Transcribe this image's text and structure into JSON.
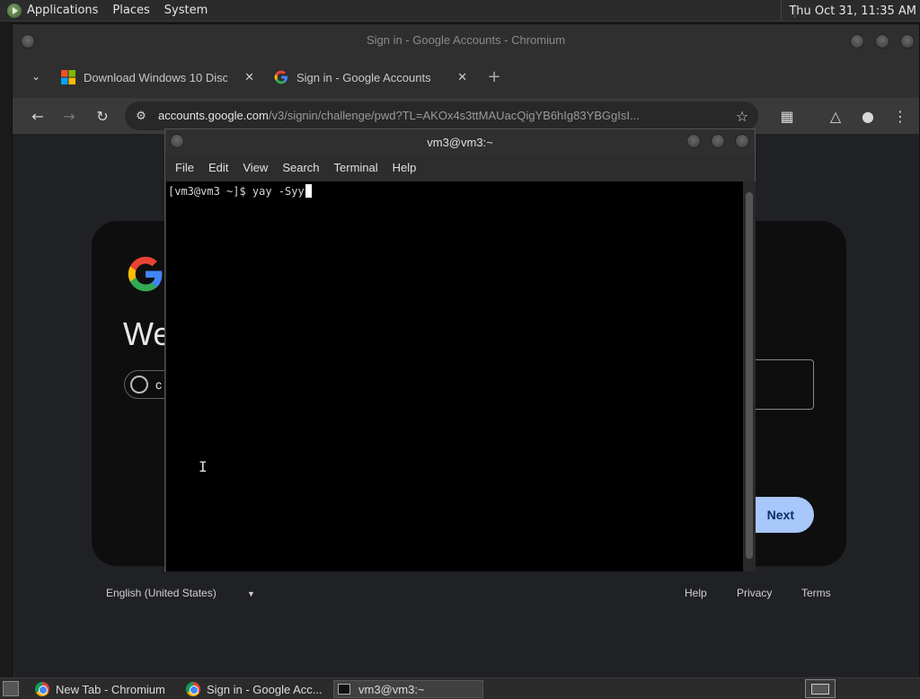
{
  "top_panel": {
    "menus": [
      "Applications",
      "Places",
      "System"
    ],
    "clock": "Thu Oct 31, 11:35 AM"
  },
  "browser": {
    "window_title": "Sign in - Google Accounts - Chromium",
    "tabs": [
      {
        "label": "Download Windows 10 Disc",
        "close": "✕"
      },
      {
        "label": "Sign in - Google Accounts",
        "close": "✕"
      }
    ],
    "new_tab": "+",
    "url_host": "accounts.google.com",
    "url_path": "/v3/signin/challenge/pwd?TL=AKOx4s3ttMAUacQigYB6hIg83YBGgIsI..."
  },
  "page": {
    "welcome": "We",
    "account_initial": "c",
    "next_label": "Next",
    "language": "English (United States)",
    "footer_links": [
      "Help",
      "Privacy",
      "Terms"
    ]
  },
  "terminal": {
    "title": "vm3@vm3:~",
    "menus": [
      "File",
      "Edit",
      "View",
      "Search",
      "Terminal",
      "Help"
    ],
    "prompt_line": "[vm3@vm3 ~]$ yay -Syy"
  },
  "taskbar": {
    "tasks": [
      "New Tab - Chromium",
      "Sign in - Google Acc...",
      "vm3@vm3:~"
    ]
  },
  "colors": {
    "accent_next": "#a8c7fa",
    "terminal_bg": "#000000"
  }
}
